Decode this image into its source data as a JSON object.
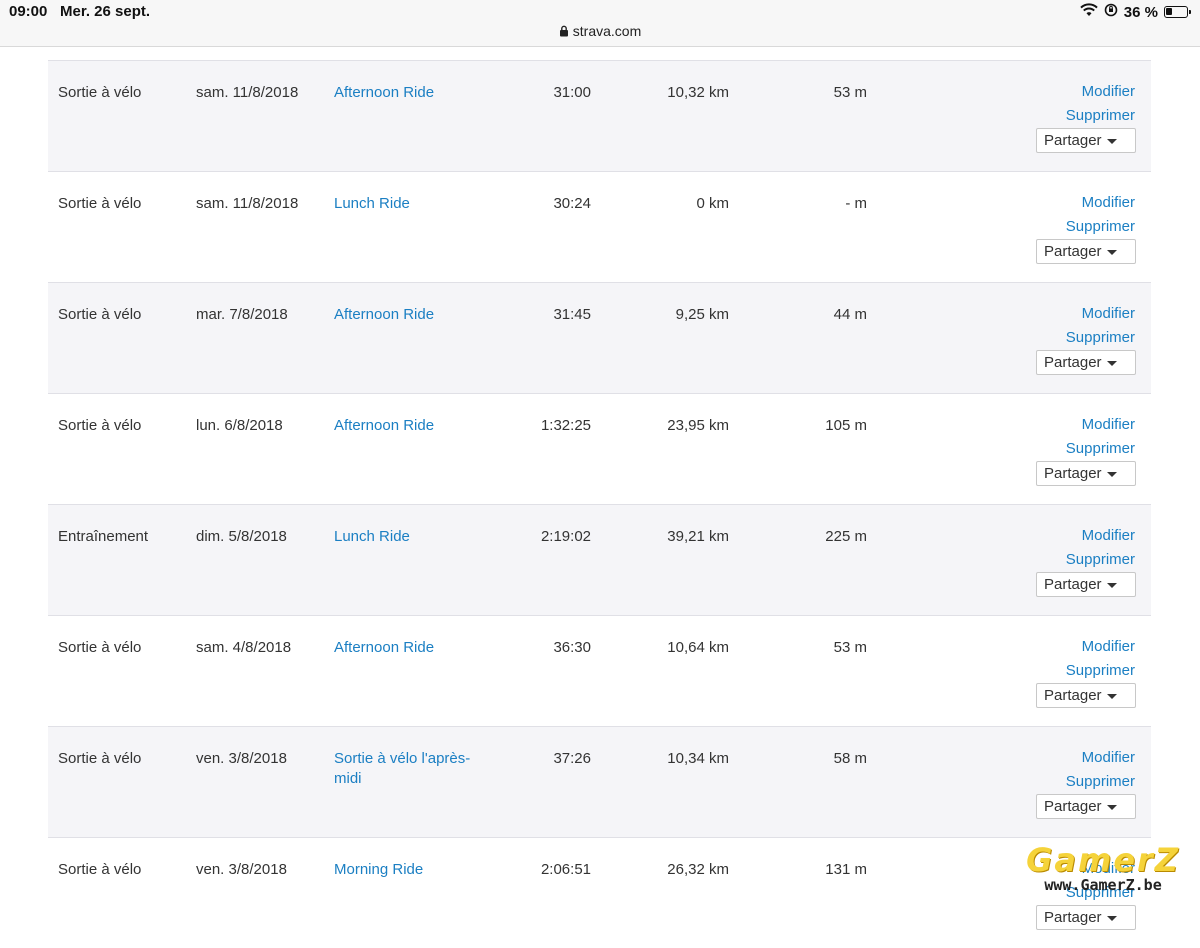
{
  "statusbar": {
    "time": "09:00",
    "date": "Mer. 26 sept.",
    "url": "strava.com",
    "battery": "36 %",
    "battery_fraction": 0.36
  },
  "table": {
    "rows": [
      {
        "type": "Sortie à vélo",
        "date": "sam. 11/8/2018",
        "title": "Afternoon Ride",
        "time": "31:00",
        "distance": "10,32 km",
        "elevation": "53 m",
        "edit": "Modifier",
        "delete": "Supprimer",
        "share": "Partager"
      },
      {
        "type": "Sortie à vélo",
        "date": "sam. 11/8/2018",
        "title": "Lunch Ride",
        "time": "30:24",
        "distance": "0 km",
        "elevation": "- m",
        "edit": "Modifier",
        "delete": "Supprimer",
        "share": "Partager"
      },
      {
        "type": "Sortie à vélo",
        "date": "mar. 7/8/2018",
        "title": "Afternoon Ride",
        "time": "31:45",
        "distance": "9,25 km",
        "elevation": "44 m",
        "edit": "Modifier",
        "delete": "Supprimer",
        "share": "Partager"
      },
      {
        "type": "Sortie à vélo",
        "date": "lun. 6/8/2018",
        "title": "Afternoon Ride",
        "time": "1:32:25",
        "distance": "23,95 km",
        "elevation": "105 m",
        "edit": "Modifier",
        "delete": "Supprimer",
        "share": "Partager"
      },
      {
        "type": "Entraînement",
        "date": "dim. 5/8/2018",
        "title": "Lunch Ride",
        "time": "2:19:02",
        "distance": "39,21 km",
        "elevation": "225 m",
        "edit": "Modifier",
        "delete": "Supprimer",
        "share": "Partager"
      },
      {
        "type": "Sortie à vélo",
        "date": "sam. 4/8/2018",
        "title": "Afternoon Ride",
        "time": "36:30",
        "distance": "10,64 km",
        "elevation": "53 m",
        "edit": "Modifier",
        "delete": "Supprimer",
        "share": "Partager"
      },
      {
        "type": "Sortie à vélo",
        "date": "ven. 3/8/2018",
        "title": "Sortie à vélo l'après-midi",
        "time": "37:26",
        "distance": "10,34 km",
        "elevation": "58 m",
        "edit": "Modifier",
        "delete": "Supprimer",
        "share": "Partager"
      },
      {
        "type": "Sortie à vélo",
        "date": "ven. 3/8/2018",
        "title": "Morning Ride",
        "time": "2:06:51",
        "distance": "26,32 km",
        "elevation": "131 m",
        "edit": "Modifier",
        "delete": "Supprimer",
        "share": "Partager"
      }
    ]
  },
  "watermark": {
    "brand": "GamerZ",
    "url": "www.GamerZ.be"
  },
  "colors": {
    "link": "#1b7fc3",
    "row_shaded": "#f5f5f8",
    "watermark": "#f5d33a"
  }
}
